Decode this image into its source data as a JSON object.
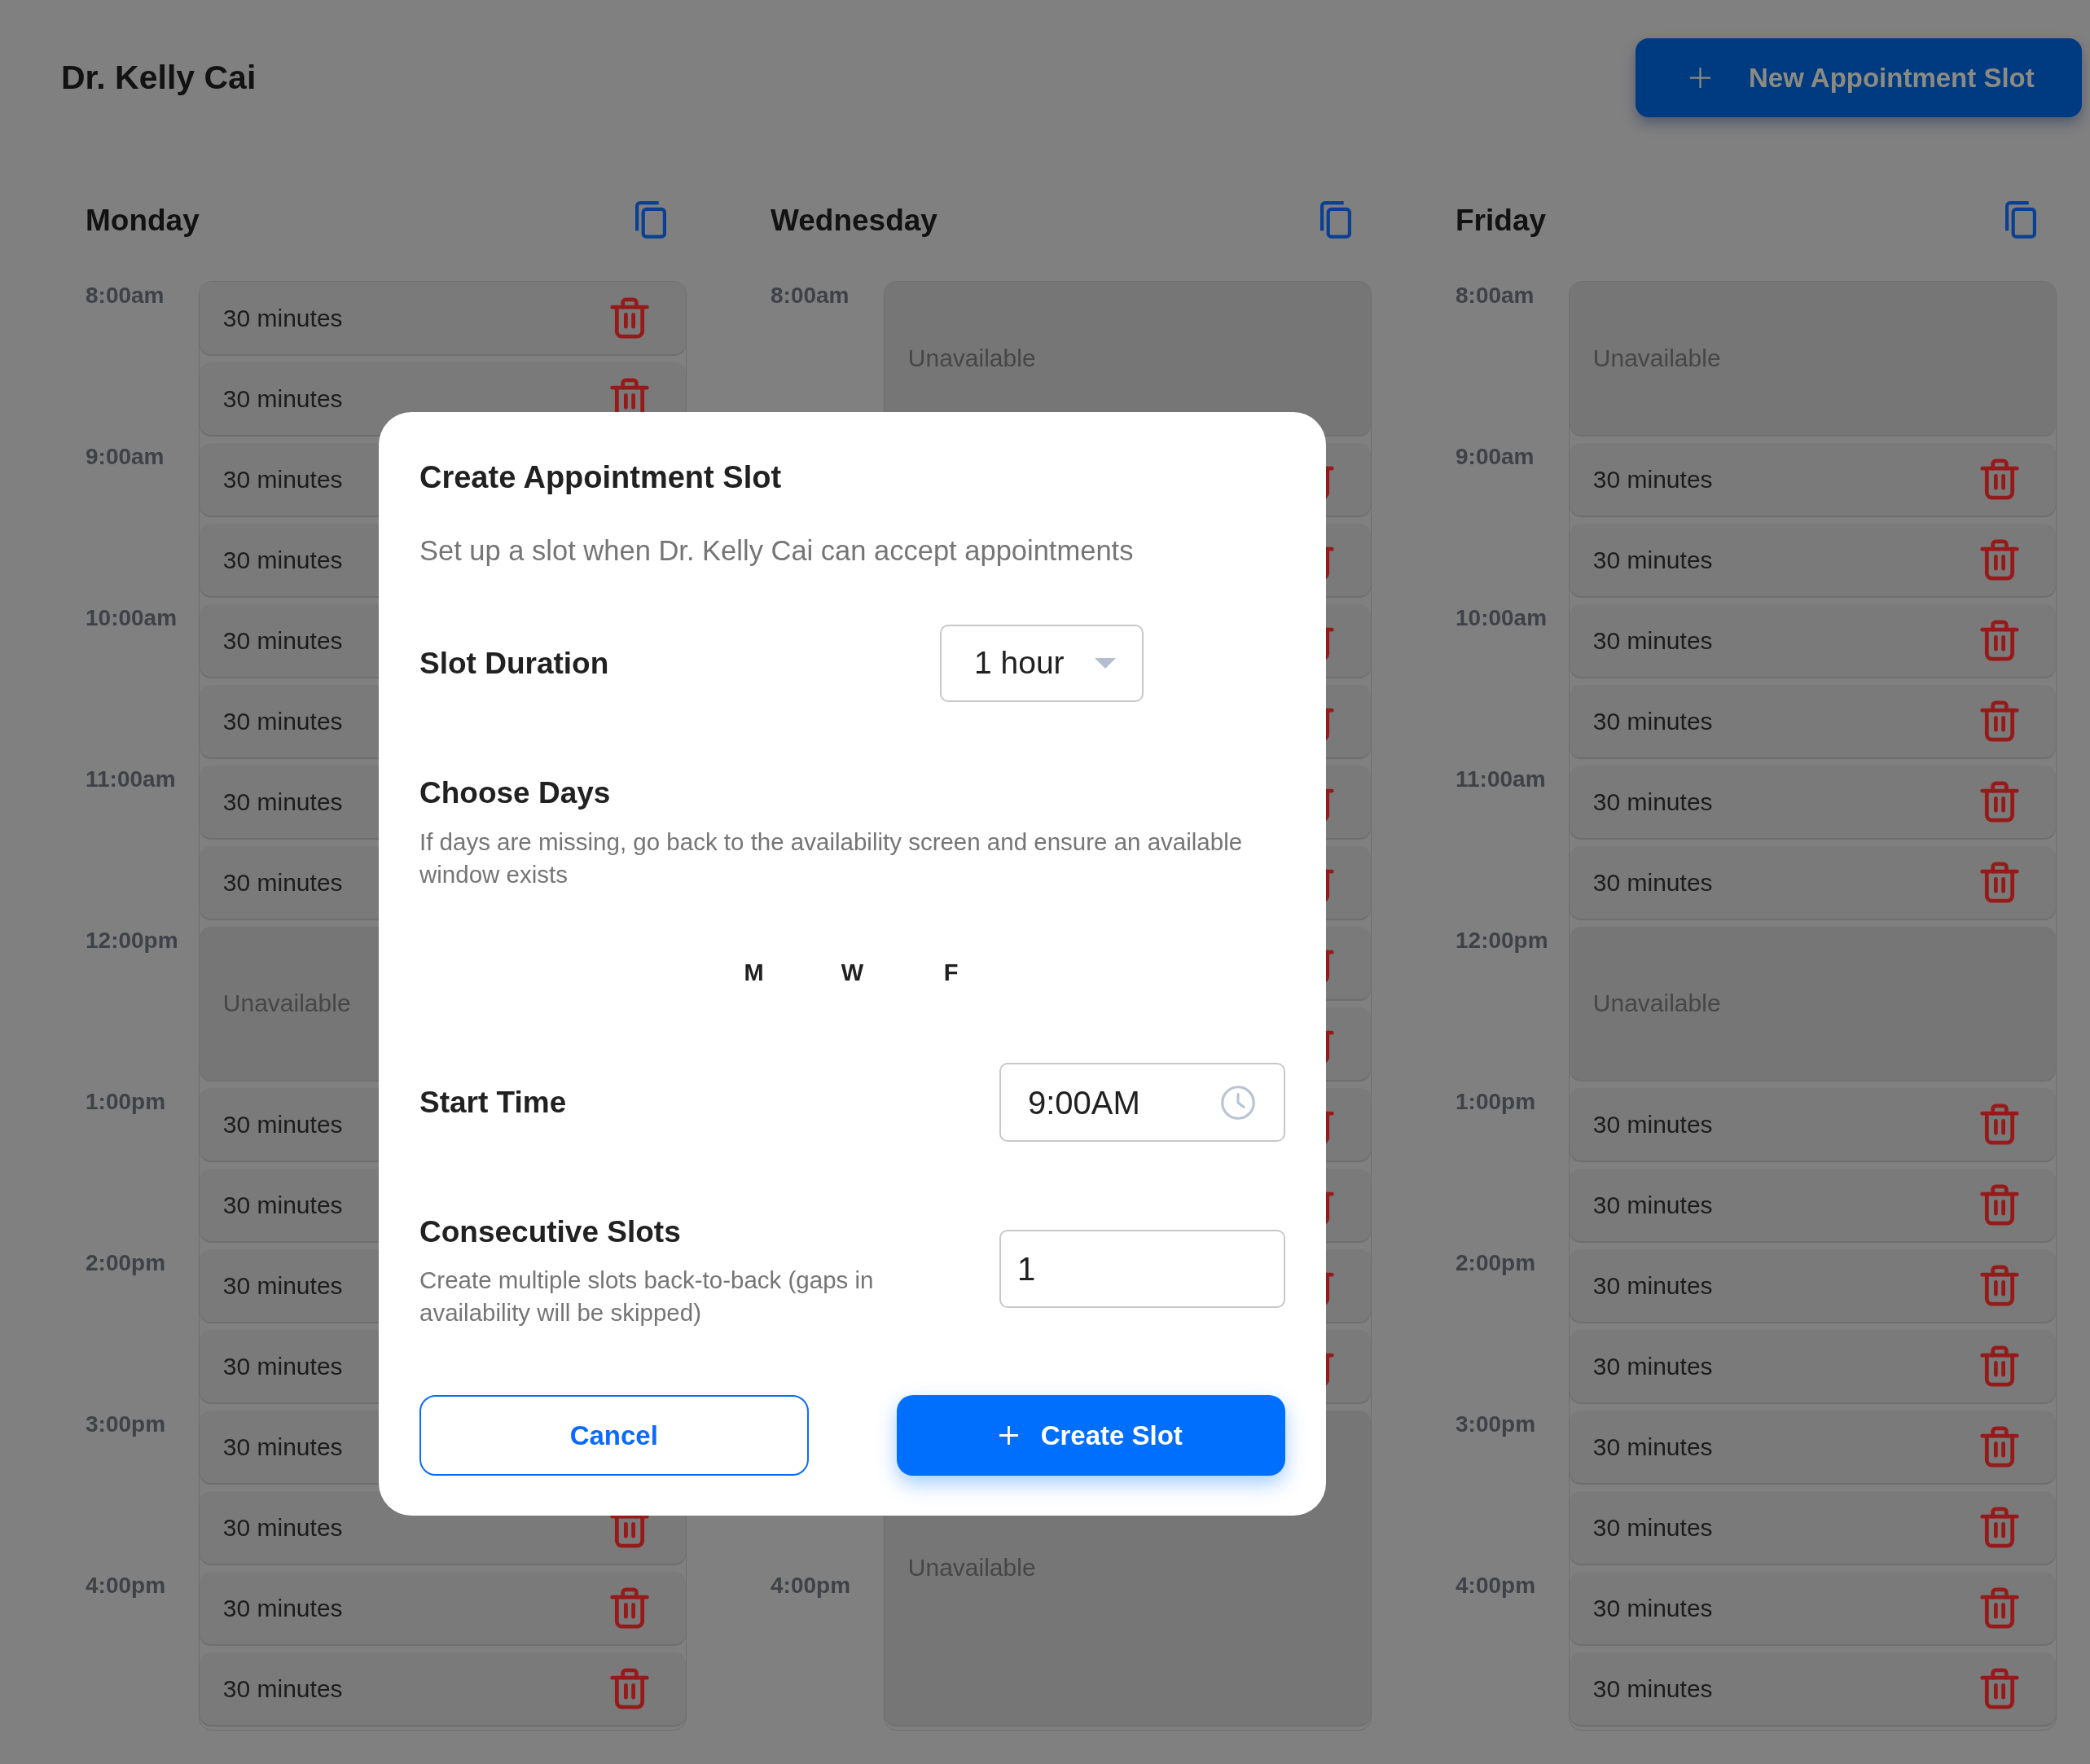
{
  "header": {
    "title": "Dr. Kelly Cai",
    "new_slot_button": {
      "label": "New Appointment Slot"
    }
  },
  "days": [
    {
      "day": "Monday",
      "times": [
        {
          "kind": "hour",
          "label": "8:00am"
        },
        {
          "kind": "hour",
          "label": "9:00am"
        },
        {
          "kind": "hour",
          "label": "10:00am"
        },
        {
          "kind": "hour",
          "label": "11:00am"
        },
        {
          "kind": "hour",
          "label": "12:00pm"
        },
        {
          "kind": "hour",
          "label": "1:00pm"
        },
        {
          "kind": "hour",
          "label": "2:00pm"
        },
        {
          "kind": "hour",
          "label": "3:00pm"
        },
        {
          "kind": "hour",
          "label": "4:00pm"
        }
      ],
      "slots": [
        {
          "kind": "slot",
          "label": "30 minutes",
          "delete_shown": true
        },
        {
          "kind": "slot",
          "label": "30 minutes",
          "delete_shown": true
        },
        {
          "kind": "slot",
          "label": "30 minutes"
        },
        {
          "kind": "slot",
          "label": "30 minutes"
        },
        {
          "kind": "slot",
          "label": "30 minutes"
        },
        {
          "kind": "slot",
          "label": "30 minutes"
        },
        {
          "kind": "slot",
          "label": "30 minutes"
        },
        {
          "kind": "slot",
          "label": "30 minutes"
        },
        {
          "kind": "unavailable",
          "label": "Unavailable",
          "long": false
        },
        {
          "kind": "slot",
          "label": "30 minutes"
        },
        {
          "kind": "slot",
          "label": "30 minutes"
        },
        {
          "kind": "slot",
          "label": "30 minutes"
        },
        {
          "kind": "slot",
          "label": "30 minutes"
        },
        {
          "kind": "slot",
          "label": "30 minutes"
        },
        {
          "kind": "slot",
          "label": "30 minutes",
          "delete_shown": true
        },
        {
          "kind": "slot",
          "label": "30 minutes",
          "delete_shown": true
        },
        {
          "kind": "slot",
          "label": "30 minutes",
          "delete_shown": true
        }
      ]
    },
    {
      "day": "Wednesday",
      "times": [
        {
          "kind": "hour",
          "label": "8:00am"
        },
        {
          "kind": "hour"
        },
        {
          "kind": "hour"
        },
        {
          "kind": "hour"
        },
        {
          "kind": "hour"
        },
        {
          "kind": "hour"
        },
        {
          "kind": "hour"
        },
        {
          "kind": "hour"
        },
        {
          "kind": "hour",
          "label": "4:00pm"
        }
      ],
      "slots": [
        {
          "kind": "unavailable",
          "label": "Unavailable",
          "long": false
        },
        {
          "kind": "slot",
          "delete_shown": true
        },
        {
          "kind": "slot",
          "delete_shown": true
        },
        {
          "kind": "slot",
          "delete_shown": true
        },
        {
          "kind": "slot",
          "delete_shown": true
        },
        {
          "kind": "slot",
          "delete_shown": true
        },
        {
          "kind": "slot",
          "delete_shown": true
        },
        {
          "kind": "slot",
          "delete_shown": true
        },
        {
          "kind": "slot",
          "delete_shown": true
        },
        {
          "kind": "slot",
          "delete_shown": true
        },
        {
          "kind": "slot",
          "delete_shown": true
        },
        {
          "kind": "slot",
          "delete_shown": true
        },
        {
          "kind": "slot",
          "delete_shown": true
        },
        {
          "kind": "unavailable",
          "label": "Unavailable",
          "long": true
        }
      ]
    },
    {
      "day": "Friday",
      "times": [
        {
          "kind": "hour",
          "label": "8:00am"
        },
        {
          "kind": "hour",
          "label": "9:00am"
        },
        {
          "kind": "hour",
          "label": "10:00am"
        },
        {
          "kind": "hour",
          "label": "11:00am"
        },
        {
          "kind": "hour",
          "label": "12:00pm"
        },
        {
          "kind": "hour",
          "label": "1:00pm"
        },
        {
          "kind": "hour",
          "label": "2:00pm"
        },
        {
          "kind": "hour",
          "label": "3:00pm"
        },
        {
          "kind": "hour",
          "label": "4:00pm"
        }
      ],
      "slots": [
        {
          "kind": "unavailable",
          "label": "Unavailable",
          "long": false
        },
        {
          "kind": "slot",
          "label": "30 minutes",
          "delete_shown": true
        },
        {
          "kind": "slot",
          "label": "30 minutes",
          "delete_shown": true
        },
        {
          "kind": "slot",
          "label": "30 minutes",
          "delete_shown": true
        },
        {
          "kind": "slot",
          "label": "30 minutes",
          "delete_shown": true
        },
        {
          "kind": "slot",
          "label": "30 minutes",
          "delete_shown": true
        },
        {
          "kind": "slot",
          "label": "30 minutes",
          "delete_shown": true
        },
        {
          "kind": "unavailable",
          "label": "Unavailable",
          "long": false
        },
        {
          "kind": "slot",
          "label": "30 minutes",
          "delete_shown": true
        },
        {
          "kind": "slot",
          "label": "30 minutes",
          "delete_shown": true
        },
        {
          "kind": "slot",
          "label": "30 minutes",
          "delete_shown": true
        },
        {
          "kind": "slot",
          "label": "30 minutes",
          "delete_shown": true
        },
        {
          "kind": "slot",
          "label": "30 minutes",
          "delete_shown": true
        },
        {
          "kind": "slot",
          "label": "30 minutes",
          "delete_shown": true
        },
        {
          "kind": "slot",
          "label": "30 minutes",
          "delete_shown": true
        },
        {
          "kind": "slot",
          "label": "30 minutes",
          "delete_shown": true
        }
      ]
    }
  ],
  "dialog": {
    "title": "Create Appointment Slot",
    "subtitle": "Set up a slot when Dr. Kelly Cai can accept appointments",
    "slot_duration": {
      "label": "Slot Duration",
      "value": "1 hour"
    },
    "choose_days": {
      "label": "Choose Days",
      "hint": "If days are missing, go back to the availability screen and ensure an available window exists",
      "days": [
        "M",
        "W",
        "F"
      ]
    },
    "start_time": {
      "label": "Start Time",
      "value": "9:00AM"
    },
    "consecutive_slots": {
      "label": "Consecutive Slots",
      "hint": "Create multiple slots back-to-back (gaps in availability will be skipped)",
      "value": "1"
    },
    "buttons": [
      {
        "kind": "secondary",
        "label": "Cancel"
      },
      {
        "kind": "primary",
        "label": "Create Slot"
      }
    ]
  }
}
